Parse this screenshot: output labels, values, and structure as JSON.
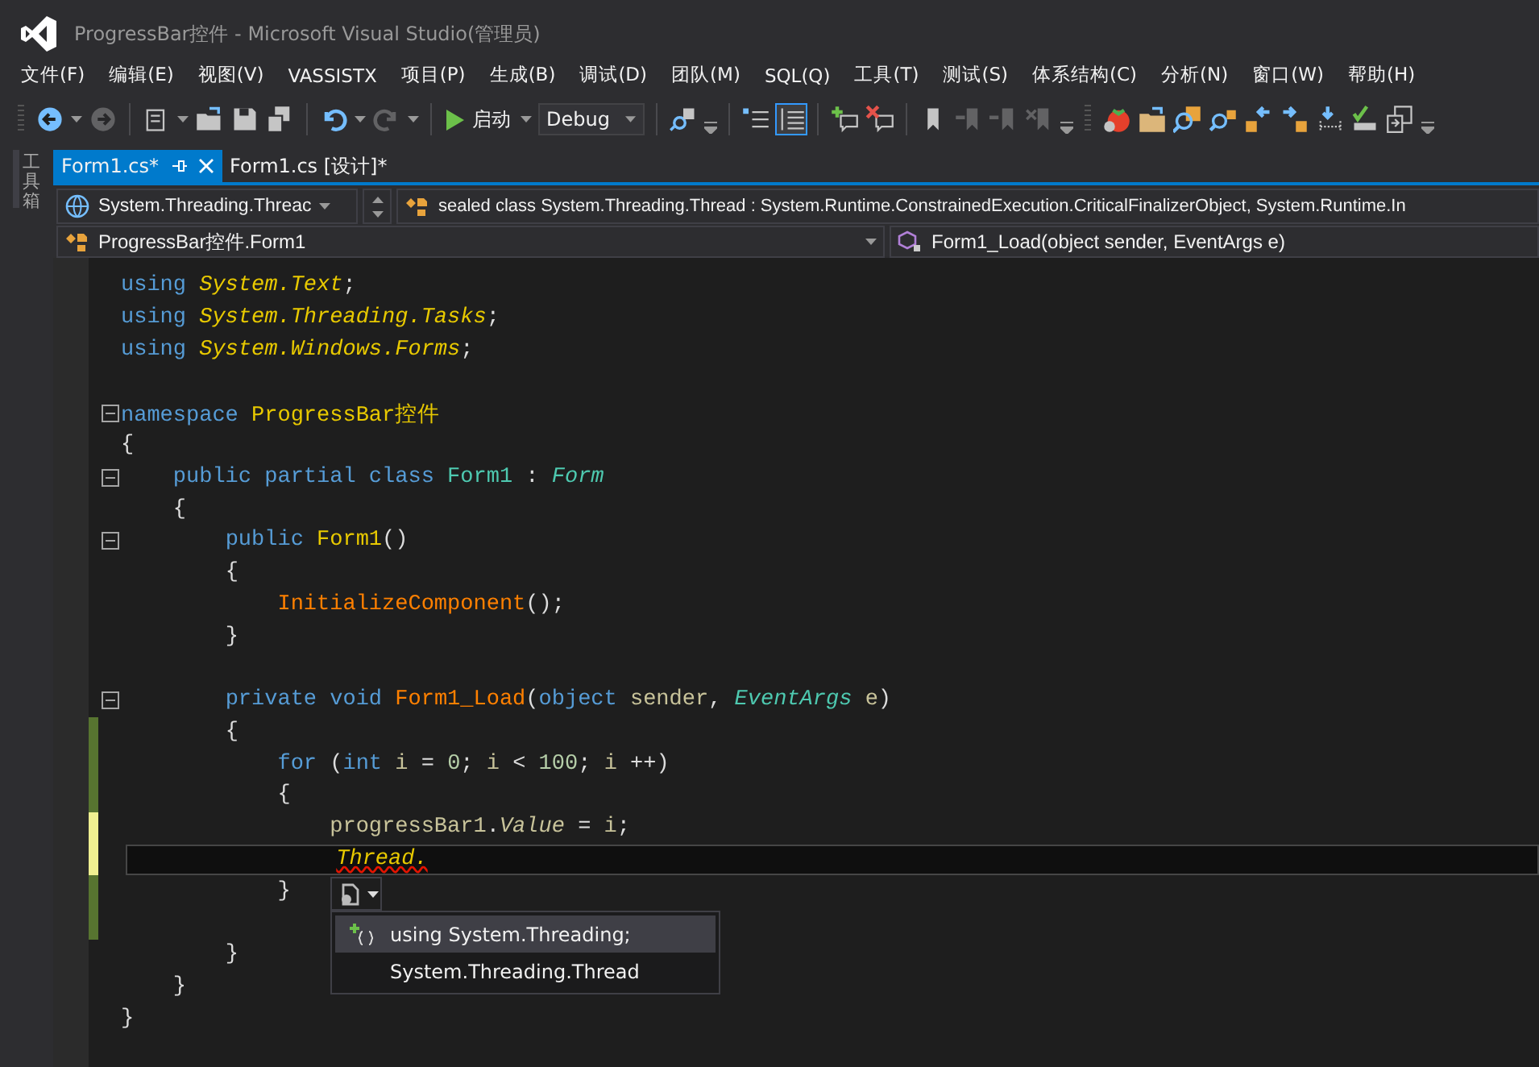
{
  "window": {
    "title": "ProgressBar控件 - Microsoft Visual Studio(管理员)"
  },
  "menu": [
    "文件(F)",
    "编辑(E)",
    "视图(V)",
    "VASSISTX",
    "项目(P)",
    "生成(B)",
    "调试(D)",
    "团队(M)",
    "SQL(Q)",
    "工具(T)",
    "测试(S)",
    "体系结构(C)",
    "分析(N)",
    "窗口(W)",
    "帮助(H)"
  ],
  "toolbar": {
    "run_label": "启动",
    "configuration": "Debug",
    "buttons": [
      {
        "disabled": false,
        "selected": false
      },
      {
        "disabled": true,
        "selected": false
      },
      {
        "disabled": false,
        "selected": false
      },
      {
        "disabled": false,
        "selected": false
      },
      {
        "disabled": false,
        "selected": false
      },
      {
        "disabled": false,
        "selected": false
      },
      {
        "disabled": false,
        "selected": false
      },
      {
        "disabled": true,
        "selected": false
      },
      {
        "disabled": false,
        "selected": false
      },
      {
        "disabled": false,
        "selected": false
      },
      {
        "disabled": false,
        "selected": true
      },
      {
        "disabled": false,
        "selected": false
      },
      {
        "disabled": false,
        "selected": false
      },
      {
        "disabled": false,
        "selected": false
      },
      {
        "disabled": true,
        "selected": false
      },
      {
        "disabled": true,
        "selected": false
      },
      {
        "disabled": true,
        "selected": false
      },
      {
        "disabled": false,
        "selected": false
      },
      {
        "disabled": false,
        "selected": false
      },
      {
        "disabled": false,
        "selected": false
      },
      {
        "disabled": false,
        "selected": false
      },
      {
        "disabled": false,
        "selected": false
      },
      {
        "disabled": false,
        "selected": false
      },
      {
        "disabled": false,
        "selected": false
      },
      {
        "disabled": false,
        "selected": false
      },
      {
        "disabled": false,
        "selected": false
      }
    ]
  },
  "toolbox_tab": "工具箱",
  "tabs": [
    {
      "label": "Form1.cs*",
      "selected": true
    },
    {
      "label": "Form1.cs [设计]*",
      "selected": false
    }
  ],
  "navigation": {
    "project": "System.Threading.Threac",
    "member_signature": "sealed class System.Threading.Thread : System.Runtime.ConstrainedExecution.CriticalFinalizerObject, System.Runtime.In",
    "type": "ProgressBar控件.Form1",
    "member": "Form1_Load(object sender, EventArgs e)"
  },
  "code_lines": [
    {
      "kind": "unchanged",
      "collapsible": false,
      "current": false,
      "tokens": [
        {
          "text": "using ",
          "kind": "keyword"
        },
        {
          "text": "System.Text",
          "kind": "namespace"
        },
        {
          "text": ";",
          "kind": "plain"
        }
      ]
    },
    {
      "kind": "unchanged",
      "collapsible": false,
      "current": false,
      "tokens": [
        {
          "text": "using ",
          "kind": "keyword"
        },
        {
          "text": "System.Threading.Tasks",
          "kind": "namespace"
        },
        {
          "text": ";",
          "kind": "plain"
        }
      ]
    },
    {
      "kind": "unchanged",
      "collapsible": false,
      "current": false,
      "tokens": [
        {
          "text": "using ",
          "kind": "keyword"
        },
        {
          "text": "System.Windows.Forms",
          "kind": "namespace"
        },
        {
          "text": ";",
          "kind": "plain"
        }
      ]
    },
    {
      "kind": "unchanged",
      "collapsible": false,
      "current": false
    },
    {
      "kind": "unchanged",
      "collapsible": true,
      "current": false,
      "tokens": [
        {
          "text": "namespace ",
          "kind": "keyword"
        },
        {
          "text": "ProgressBar控件",
          "kind": "name"
        }
      ]
    },
    {
      "kind": "unchanged",
      "collapsible": false,
      "current": false,
      "tokens": [
        {
          "text": "{",
          "kind": "plain"
        }
      ]
    },
    {
      "kind": "unchanged",
      "collapsible": true,
      "current": false,
      "tokens": [
        {
          "text": "    public partial class ",
          "kind": "keyword"
        },
        {
          "text": "Form1",
          "kind": "type"
        },
        {
          "text": " : ",
          "kind": "plain"
        },
        {
          "text": "Form",
          "kind": "typeitalic"
        }
      ]
    },
    {
      "kind": "unchanged",
      "collapsible": false,
      "current": false,
      "tokens": [
        {
          "text": "    {",
          "kind": "plain"
        }
      ]
    },
    {
      "kind": "unchanged",
      "collapsible": true,
      "current": false,
      "tokens": [
        {
          "text": "        public ",
          "kind": "keyword"
        },
        {
          "text": "Form1",
          "kind": "name"
        },
        {
          "text": "()",
          "kind": "plain"
        }
      ]
    },
    {
      "kind": "unchanged",
      "collapsible": false,
      "current": false,
      "tokens": [
        {
          "text": "        {",
          "kind": "plain"
        }
      ]
    },
    {
      "kind": "unchanged",
      "collapsible": false,
      "current": false,
      "tokens": [
        {
          "text": "            InitializeComponent",
          "kind": "method"
        },
        {
          "text": "();",
          "kind": "plain"
        }
      ]
    },
    {
      "kind": "unchanged",
      "collapsible": false,
      "current": false,
      "tokens": [
        {
          "text": "        }",
          "kind": "plain"
        }
      ]
    },
    {
      "kind": "unchanged",
      "collapsible": false,
      "current": false
    },
    {
      "kind": "unchanged",
      "collapsible": true,
      "current": false,
      "tokens": [
        {
          "text": "        private void ",
          "kind": "keyword"
        },
        {
          "text": "Form1_Load",
          "kind": "method"
        },
        {
          "text": "(",
          "kind": "plain"
        },
        {
          "text": "object ",
          "kind": "keyword"
        },
        {
          "text": "sender",
          "kind": "identifier"
        },
        {
          "text": ", ",
          "kind": "plain"
        },
        {
          "text": "EventArgs",
          "kind": "typeitalic"
        },
        {
          "text": " e",
          "kind": "identifier"
        },
        {
          "text": ")",
          "kind": "plain"
        }
      ]
    },
    {
      "kind": "saved",
      "collapsible": false,
      "current": false,
      "tokens": [
        {
          "text": "        {",
          "kind": "plain"
        }
      ]
    },
    {
      "kind": "saved",
      "collapsible": false,
      "current": false,
      "tokens": [
        {
          "text": "            for ",
          "kind": "keyword"
        },
        {
          "text": "(",
          "kind": "plain"
        },
        {
          "text": "int ",
          "kind": "keyword"
        },
        {
          "text": "i",
          "kind": "identifier"
        },
        {
          "text": " = ",
          "kind": "plain"
        },
        {
          "text": "0",
          "kind": "number"
        },
        {
          "text": "; ",
          "kind": "plain"
        },
        {
          "text": "i",
          "kind": "identifier"
        },
        {
          "text": " < ",
          "kind": "plain"
        },
        {
          "text": "100",
          "kind": "number"
        },
        {
          "text": "; ",
          "kind": "plain"
        },
        {
          "text": "i",
          "kind": "identifier"
        },
        {
          "text": " ++)",
          "kind": "plain"
        }
      ]
    },
    {
      "kind": "saved",
      "collapsible": false,
      "current": false,
      "tokens": [
        {
          "text": "            {",
          "kind": "plain"
        }
      ]
    },
    {
      "kind": "unsaved",
      "collapsible": false,
      "current": false,
      "tokens": [
        {
          "text": "                progressBar1",
          "kind": "identifier"
        },
        {
          "text": ".",
          "kind": "plain"
        },
        {
          "text": "Value",
          "kind": "property"
        },
        {
          "text": " = ",
          "kind": "plain"
        },
        {
          "text": "i",
          "kind": "identifier"
        },
        {
          "text": ";",
          "kind": "plain"
        }
      ]
    },
    {
      "kind": "unsaved",
      "collapsible": false,
      "current": true,
      "tokens": [
        {
          "text": "                Thread.",
          "kind": "error"
        }
      ]
    },
    {
      "kind": "saved",
      "collapsible": false,
      "current": false,
      "tokens": [
        {
          "text": "            }",
          "kind": "plain"
        }
      ]
    },
    {
      "kind": "saved",
      "collapsible": false,
      "current": false
    },
    {
      "kind": "unchanged",
      "collapsible": false,
      "current": false,
      "tokens": [
        {
          "text": "        }",
          "kind": "plain"
        }
      ]
    },
    {
      "kind": "unchanged",
      "collapsible": false,
      "current": false,
      "tokens": [
        {
          "text": "    }",
          "kind": "plain"
        }
      ]
    },
    {
      "kind": "unchanged",
      "collapsible": false,
      "current": false,
      "tokens": [
        {
          "text": "}",
          "kind": "plain"
        }
      ]
    }
  ],
  "quick_actions": {
    "items": [
      {
        "text": "using System.Threading;",
        "selected": true,
        "kind": "add-using"
      },
      {
        "text": "System.Threading.Thread",
        "selected": false,
        "kind": "qualify"
      }
    ]
  }
}
